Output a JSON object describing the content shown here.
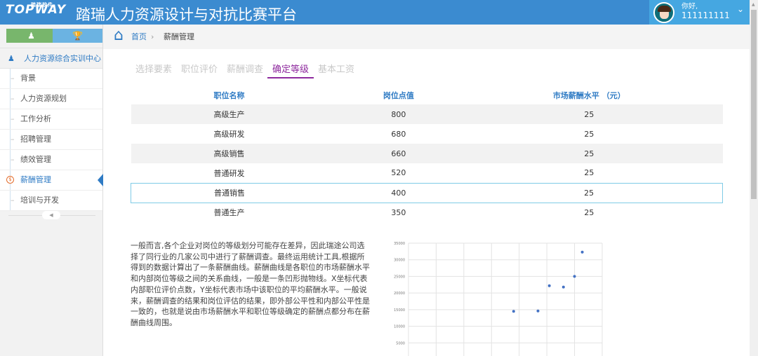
{
  "header": {
    "logo": "TOPWAY",
    "logo_sub": "踏瑞软件",
    "title": "踏瑞人力资源设计与对抗比赛平台",
    "greeting": "你好,",
    "user_id": "111111111"
  },
  "sidebar": {
    "center_label": "人力资源综合实训中心",
    "items": [
      {
        "label": "背景"
      },
      {
        "label": "人力资源规划"
      },
      {
        "label": "工作分析"
      },
      {
        "label": "招聘管理"
      },
      {
        "label": "绩效管理"
      },
      {
        "label": "薪酬管理",
        "active": true
      },
      {
        "label": "培训与开发"
      }
    ]
  },
  "breadcrumb": {
    "home": "首页",
    "current": "薪酬管理"
  },
  "tabs": [
    {
      "label": "选择要素"
    },
    {
      "label": "职位评价"
    },
    {
      "label": "薪酬调查"
    },
    {
      "label": "确定等级",
      "active": true
    },
    {
      "label": "基本工资"
    }
  ],
  "table": {
    "headers": [
      "职位名称",
      "岗位点值",
      "市场薪酬水平 （元）"
    ],
    "rows": [
      [
        "高级生产",
        "800",
        "25"
      ],
      [
        "高级研发",
        "680",
        "25"
      ],
      [
        "高级销售",
        "660",
        "25"
      ],
      [
        "普通研发",
        "520",
        "25"
      ],
      [
        "普通销售",
        "400",
        "25"
      ],
      [
        "普通生产",
        "350",
        "25"
      ]
    ],
    "selected_row": 4
  },
  "paragraph": "一般而言,各个企业对岗位的等级划分可能存在差异，因此瑞途公司选择了同行业的几家公司中进行了薪酬调查。最终运用统计工具,根据所得到的数据计算出了一条薪酬曲线。薪酬曲线是各职位的市场薪酬水平和内部岗位等级之间的关系曲线，一般是一条凹形抛物线。X坐标代表内部职位评价点数，Y坐标代表市场中该职位的平均薪酬水平。一般说来，薪酬调查的结果和岗位评估的结果，即外部公平性和内部公平性是一致的，也就是说由市场薪酬水平和职位等级确定的薪酬点都分布在薪酬曲线周围。",
  "colors": {
    "header": "#3b8bd0",
    "accent": "#2f7bc4",
    "tab_active": "#8e2a9e",
    "point": "#4472c4"
  },
  "chart_data": {
    "type": "scatter",
    "grid": true,
    "xlim": [
      0,
      700
    ],
    "ylim": [
      0,
      35000
    ],
    "yticks": [
      "35000",
      "30000",
      "25000",
      "20000",
      "15000",
      "10000",
      "5000"
    ],
    "points": [
      [
        380,
        14500
      ],
      [
        468,
        14600
      ],
      [
        509,
        22200
      ],
      [
        560,
        21800
      ],
      [
        600,
        25000
      ],
      [
        628,
        32300
      ]
    ]
  }
}
